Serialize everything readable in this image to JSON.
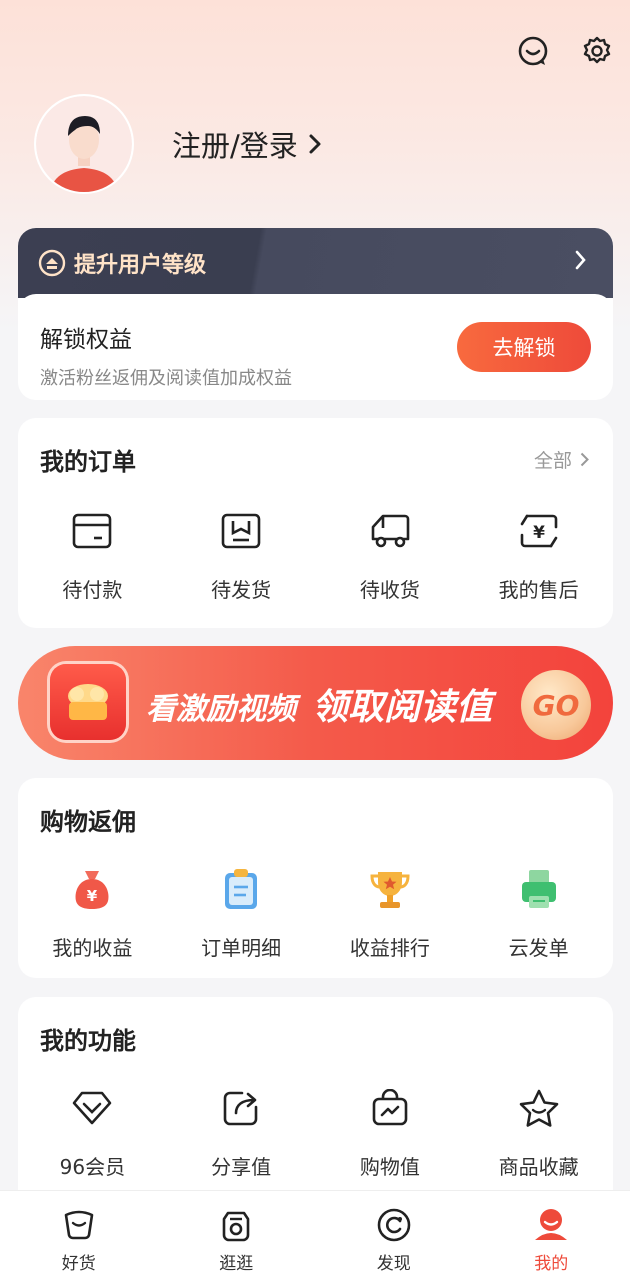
{
  "header": {
    "icons": [
      "chat-icon",
      "settings-icon"
    ]
  },
  "profile": {
    "login_label": "注册/登录",
    "chevron": "›"
  },
  "upgrade": {
    "title": "提升用户等级",
    "body_title": "解锁权益",
    "body_subtitle": "激活粉丝返佣及阅读值加成权益",
    "button": "去解锁"
  },
  "orders": {
    "title": "我的订单",
    "more": "全部",
    "items": [
      {
        "label": "待付款",
        "icon": "wallet-icon"
      },
      {
        "label": "待发货",
        "icon": "box-icon"
      },
      {
        "label": "待收货",
        "icon": "truck-icon"
      },
      {
        "label": "我的售后",
        "icon": "yen-refund-icon"
      }
    ]
  },
  "banner": {
    "text1": "看激励视频",
    "text2": "领取阅读值",
    "go": "GO"
  },
  "rebate": {
    "title": "购物返佣",
    "items": [
      {
        "label": "我的收益",
        "icon": "money-bag-icon"
      },
      {
        "label": "订单明细",
        "icon": "clipboard-icon"
      },
      {
        "label": "收益排行",
        "icon": "trophy-icon"
      },
      {
        "label": "云发单",
        "icon": "printer-icon"
      }
    ]
  },
  "features": {
    "title": "我的功能",
    "items": [
      {
        "label": "96会员",
        "icon": "diamond-icon"
      },
      {
        "label": "分享值",
        "icon": "share-icon"
      },
      {
        "label": "购物值",
        "icon": "shopping-bag-icon"
      },
      {
        "label": "商品收藏",
        "icon": "star-icon"
      }
    ]
  },
  "tabbar": {
    "tabs": [
      {
        "label": "好货",
        "icon": "cup-icon"
      },
      {
        "label": "逛逛",
        "icon": "browse-icon"
      },
      {
        "label": "发现",
        "icon": "discover-icon"
      },
      {
        "label": "我的",
        "icon": "user-icon",
        "active": true
      }
    ]
  },
  "colors": {
    "accent": "#ee4a3a",
    "upgrade_bg": "#3c3f52",
    "upgrade_text": "#ffe3c8"
  }
}
